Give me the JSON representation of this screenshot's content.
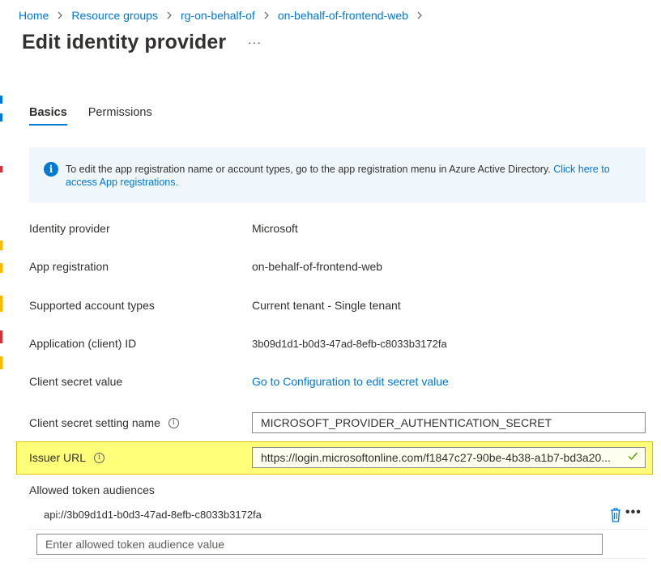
{
  "breadcrumb": [
    {
      "label": "Home"
    },
    {
      "label": "Resource groups"
    },
    {
      "label": "rg-on-behalf-of"
    },
    {
      "label": "on-behalf-of-frontend-web"
    }
  ],
  "page": {
    "title": "Edit identity provider",
    "more_label": "···"
  },
  "tabs": [
    {
      "label": "Basics",
      "active": true
    },
    {
      "label": "Permissions",
      "active": false
    }
  ],
  "info_banner": {
    "icon": "info-icon",
    "text": "To edit the app registration name or account types, go to the app registration menu in Azure Active Directory. ",
    "link_text": "Click here to access App registrations."
  },
  "fields": {
    "identity_provider": {
      "label": "Identity provider",
      "value": "Microsoft"
    },
    "app_registration": {
      "label": "App registration",
      "value": "on-behalf-of-frontend-web"
    },
    "supported_account_types": {
      "label": "Supported account types",
      "value": "Current tenant - Single tenant"
    },
    "client_id": {
      "label": "Application (client) ID",
      "value": "3b09d1d1-b0d3-47ad-8efb-c8033b3172fa"
    },
    "client_secret_value": {
      "label": "Client secret value",
      "value": "Go to Configuration to edit secret value"
    },
    "client_secret_setting_name": {
      "label": "Client secret setting name",
      "value": "MICROSOFT_PROVIDER_AUTHENTICATION_SECRET"
    },
    "issuer_url": {
      "label": "Issuer URL",
      "value": "https://login.microsoftonline.com/f1847c27-90be-4b38-a1b7-bd3a20..."
    }
  },
  "allowed_audiences": {
    "label": "Allowed token audiences",
    "items": [
      "api://3b09d1d1-b0d3-47ad-8efb-c8033b3172fa"
    ],
    "placeholder": "Enter allowed token audience value"
  },
  "colors": {
    "accent": "#0078d4",
    "highlight": "#ffff7a",
    "info_bg": "#eff6fc",
    "valid": "#57a300"
  }
}
